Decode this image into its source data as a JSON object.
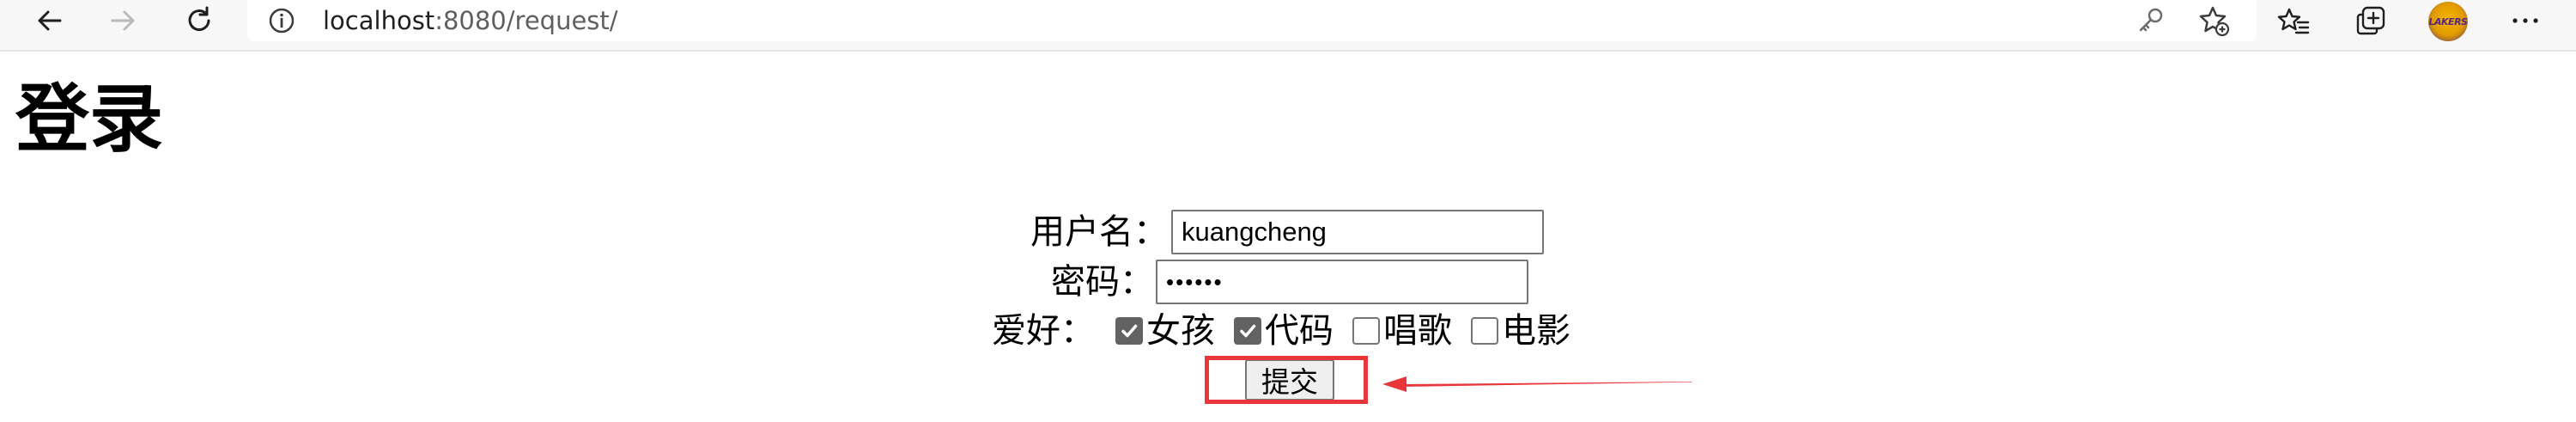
{
  "browser": {
    "url_host": "localhost",
    "url_rest": ":8080/request/",
    "icons": {
      "back": "back-arrow-icon",
      "forward": "forward-arrow-icon",
      "refresh": "refresh-icon",
      "info": "info-icon",
      "key": "key-icon",
      "favorite": "star-add-icon",
      "favorites_list": "favorites-list-icon",
      "collections": "collections-icon",
      "more": "ellipsis-icon"
    },
    "avatar_text": "LAKERS"
  },
  "page": {
    "title": "登录",
    "form": {
      "username_label": "用户名：",
      "username_value": "kuangcheng",
      "password_label": "密码：",
      "password_value": "••••••",
      "hobby_label": "爱好：",
      "hobbies": [
        {
          "label": "女孩",
          "checked": true
        },
        {
          "label": "代码",
          "checked": true
        },
        {
          "label": "唱歌",
          "checked": false
        },
        {
          "label": "电影",
          "checked": false
        }
      ],
      "submit_label": "提交"
    }
  },
  "annotation": {
    "highlight_color": "#e8363a"
  }
}
